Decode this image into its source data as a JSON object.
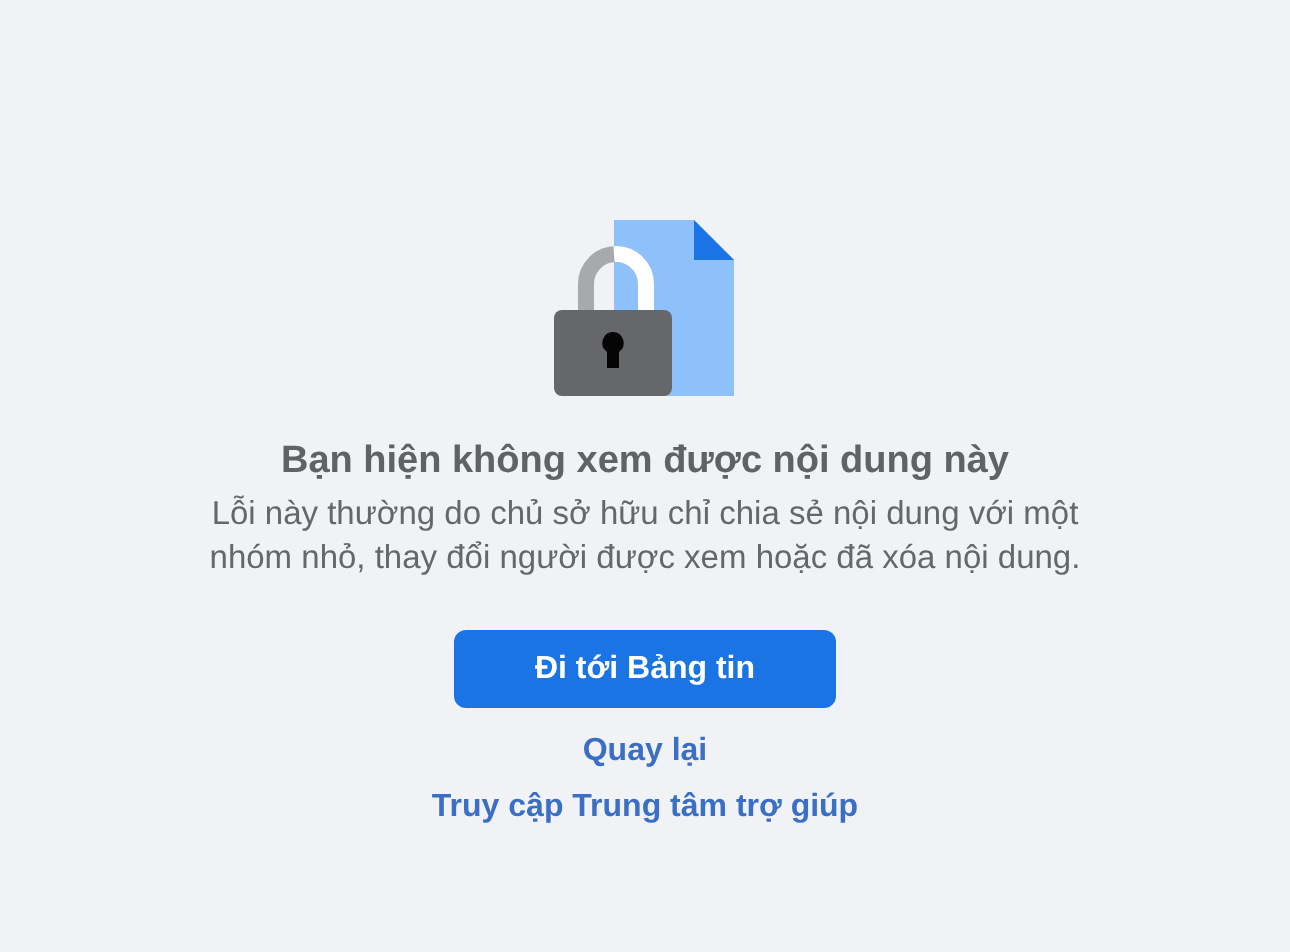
{
  "notice": {
    "title": "Bạn hiện không xem được nội dung này",
    "message": "Lỗi này thường do chủ sở hữu chỉ chia sẻ nội dung với một nhóm nhỏ, thay đổi người được xem hoặc đã xóa nội dung.",
    "primary_button": "Đi tới Bảng tin",
    "links": [
      "Quay lại",
      "Truy cập Trung tâm trợ giúp"
    ]
  }
}
